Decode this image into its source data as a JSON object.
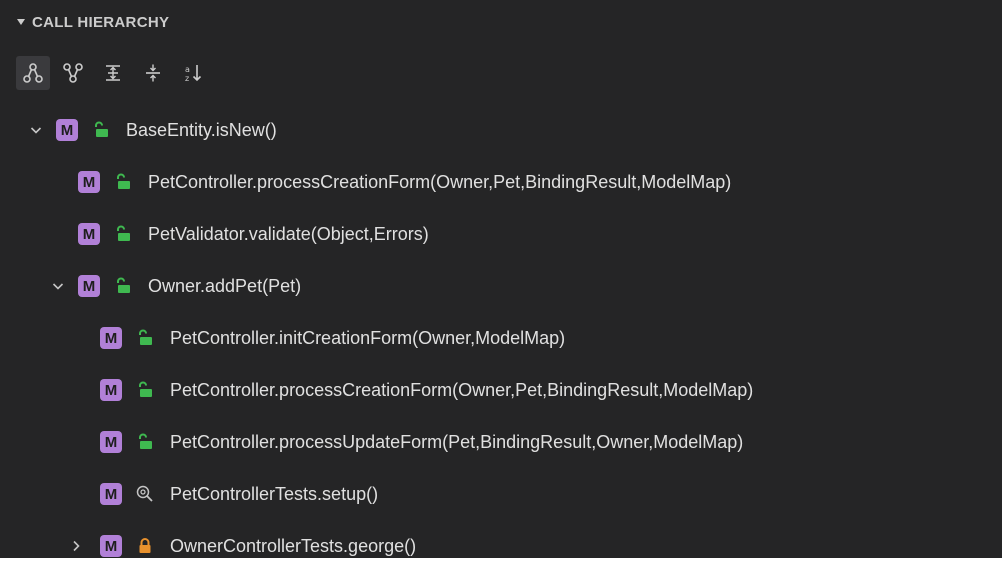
{
  "panel": {
    "title": "CALL HIERARCHY",
    "toolbar": [
      {
        "icon": "call-hierarchy-incoming-icon",
        "active": true
      },
      {
        "icon": "call-hierarchy-outgoing-icon",
        "active": false
      },
      {
        "icon": "expand-all-icon",
        "active": false
      },
      {
        "icon": "collapse-all-icon",
        "active": false
      },
      {
        "icon": "sort-icon",
        "active": false
      }
    ]
  },
  "tree": [
    {
      "label": "BaseEntity.isNew()",
      "badge": "M",
      "modifier": "public",
      "expander": "expanded"
    },
    {
      "label": "PetController.processCreationForm(Owner,Pet,BindingResult,ModelMap)",
      "badge": "M",
      "modifier": "public",
      "expander": "none"
    },
    {
      "label": "PetValidator.validate(Object,Errors)",
      "badge": "M",
      "modifier": "public",
      "expander": "none"
    },
    {
      "label": "Owner.addPet(Pet)",
      "badge": "M",
      "modifier": "public",
      "expander": "expanded"
    },
    {
      "label": "PetController.initCreationForm(Owner,ModelMap)",
      "badge": "M",
      "modifier": "public",
      "expander": "none"
    },
    {
      "label": "PetController.processCreationForm(Owner,Pet,BindingResult,ModelMap)",
      "badge": "M",
      "modifier": "public",
      "expander": "none"
    },
    {
      "label": "PetController.processUpdateForm(Pet,BindingResult,Owner,ModelMap)",
      "badge": "M",
      "modifier": "public",
      "expander": "none"
    },
    {
      "label": "PetControllerTests.setup()",
      "badge": "M",
      "modifier": "test",
      "expander": "none"
    },
    {
      "label": "OwnerControllerTests.george()",
      "badge": "M",
      "modifier": "private",
      "expander": "collapsed"
    }
  ],
  "colors": {
    "background": "#252526",
    "method_badge": "#b180d7",
    "public_lock": "#3fb950",
    "private_lock": "#e8912d",
    "text": "#e0e0e0"
  }
}
